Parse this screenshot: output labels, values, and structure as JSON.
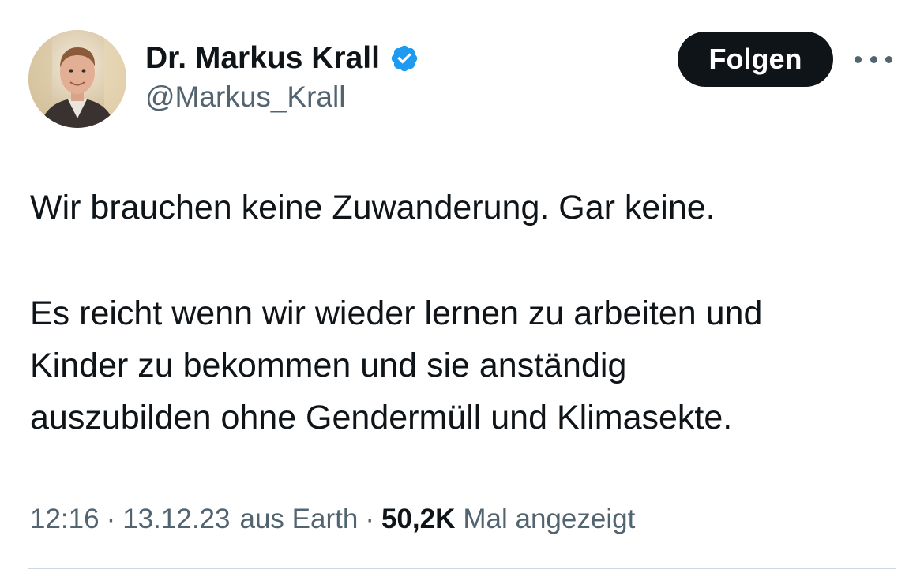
{
  "author": {
    "display_name": "Dr. Markus Krall",
    "handle": "@Markus_Krall",
    "verified": true,
    "verified_color": "#1d9bf0"
  },
  "actions": {
    "follow_label": "Folgen",
    "more_icon": "more-horizontal-icon"
  },
  "tweet": {
    "lines": [
      "Wir brauchen keine Zuwanderung. Gar keine.",
      "Es reicht wenn wir wieder lernen zu arbeiten und",
      "Kinder zu bekommen und sie anständig",
      "auszubilden ohne Gendermüll und Klimasekte."
    ]
  },
  "meta": {
    "time": "12:16",
    "date": "13.12.23",
    "location": "aus Earth",
    "views_count": "50,2K",
    "views_label": "Mal angezeigt",
    "separator": "·"
  },
  "colors": {
    "text_primary": "#0f1419",
    "text_secondary": "#536471",
    "button_bg": "#0f1419",
    "divider": "#cfd9de"
  }
}
